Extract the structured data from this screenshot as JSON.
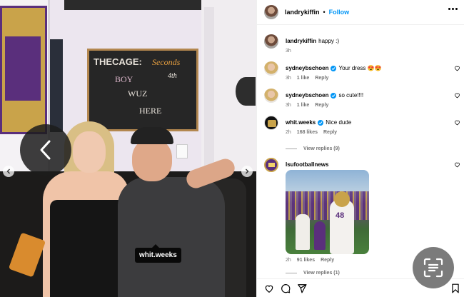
{
  "photo": {
    "tag_username": "whit.weeks",
    "chalkboard_text": "THECAGE: Seconds · BOY · WUZ · HERE · 4th",
    "prev_icon": "chevron-left-icon",
    "next_icon": "chevron-right-icon"
  },
  "header": {
    "username": "landrykiffin",
    "separator": "•",
    "follow_label": "Follow",
    "more_icon": "more-horizontal-icon"
  },
  "caption": {
    "username": "landrykiffin",
    "text": "happy :)",
    "time": "3h"
  },
  "comments": [
    {
      "username": "sydneybschoen",
      "verified": true,
      "text": "Your dress 😍😍",
      "time": "3h",
      "likes": "1 like",
      "reply_label": "Reply"
    },
    {
      "username": "sydneybschoen",
      "verified": true,
      "text": "so cute!!!!",
      "time": "3h",
      "likes": "1 like",
      "reply_label": "Reply"
    },
    {
      "username": "whit.weeks",
      "verified": true,
      "text": "Nice dude",
      "time": "2h",
      "likes": "168 likes",
      "reply_label": "Reply",
      "view_replies": "View replies (9)"
    },
    {
      "username": "lsufootballnews",
      "verified": false,
      "text": "",
      "time": "2h",
      "likes": "91 likes",
      "reply_label": "Reply",
      "view_replies": "View replies (1)",
      "image_number": "48"
    }
  ],
  "actions": {
    "like_icon": "heart-icon",
    "comment_icon": "comment-icon",
    "share_icon": "send-icon",
    "save_icon": "bookmark-icon"
  },
  "colors": {
    "accent": "#0095f6",
    "meta_text": "#737373",
    "lsu_purple": "#5a2f7c",
    "lsu_gold": "#c9a34a"
  }
}
